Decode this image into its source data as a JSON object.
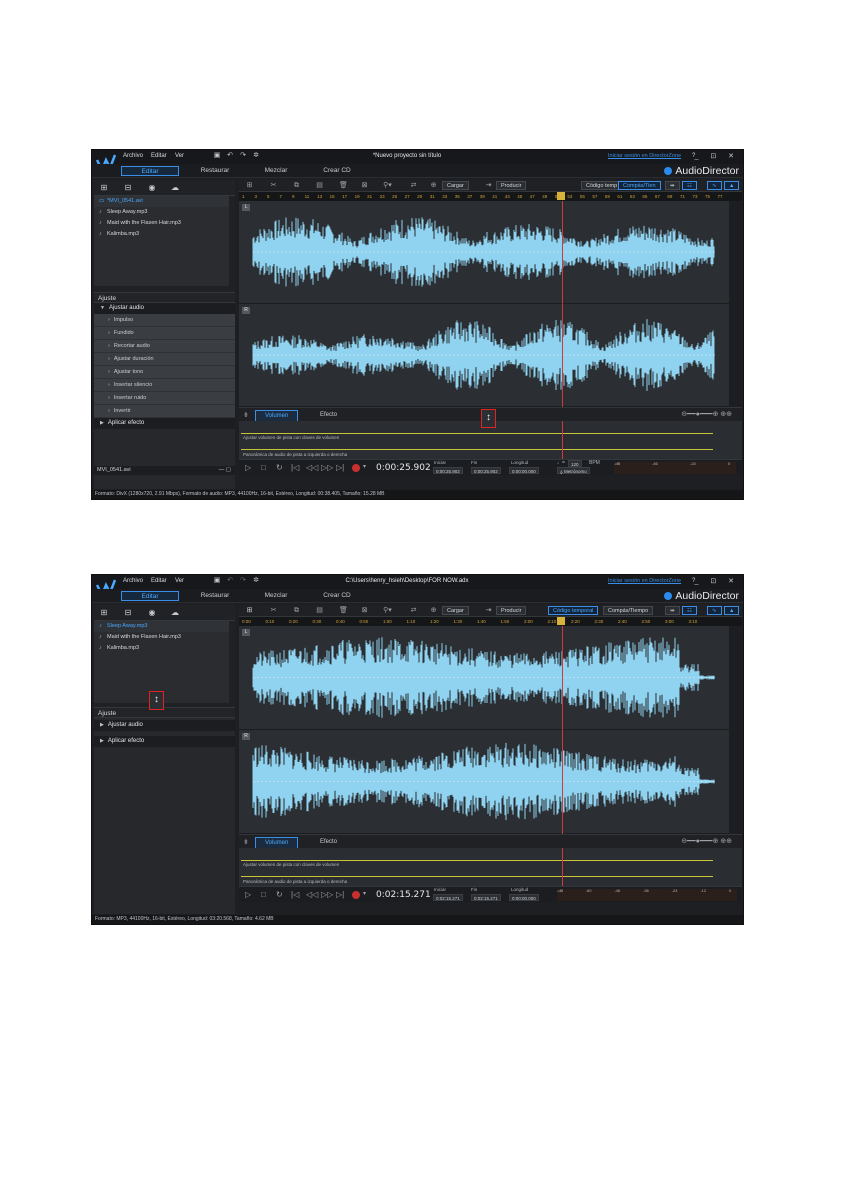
{
  "shot1": {
    "menu": [
      "Archivo",
      "Editar",
      "Ver"
    ],
    "title": "*Nuevo proyecto sin título",
    "signin": "Iniciar sesión en DirectorZone",
    "help": "?",
    "win_controls": "_ ⊡ ✕",
    "tabs": [
      "Editar",
      "Restaurar",
      "Mezclar",
      "Crear CD"
    ],
    "brand": "AudioDirector",
    "files": [
      "*MVI_0541.avi",
      "Sleep Away.mp3",
      "Maid with the Flaxen Hair.mp3",
      "Kalimba.mp3"
    ],
    "ajuste": "Ajuste",
    "ajustar_audio": "Ajustar audio",
    "sub_items": [
      "Impulso",
      "Fundido",
      "Recortar audio",
      "Ajustar duración",
      "Ajustar tono",
      "Insertar silencio",
      "Insertar ruido",
      "Invertir"
    ],
    "aplicar_efecto": "Aplicar efecto",
    "file_tab": "MVI_0541.avi",
    "cargar": "Cargar",
    "producir": "Producir",
    "codigo": "Código temp",
    "compas": "Compás/Tien",
    "ruler": [
      "1",
      "3",
      "5",
      "7",
      "9",
      "11",
      "13",
      "15",
      "17",
      "19",
      "21",
      "23",
      "25",
      "27",
      "29",
      "31",
      "33",
      "35",
      "37",
      "39",
      "41",
      "43",
      "45",
      "47",
      "49",
      "51",
      "53",
      "55",
      "57",
      "59",
      "61",
      "63",
      "65",
      "67",
      "69",
      "71",
      "73",
      "75",
      "77"
    ],
    "track_labels": [
      "L",
      "R"
    ],
    "volumen": "Volumen",
    "efecto": "Efecto",
    "env_vol": "Ajustar volumen de pista con claves de volumen",
    "env_pan": "Panorámica de audio de pista a izquierda o derecha",
    "timecode": "0:00:25.902",
    "iniciar": "Iniciar",
    "fin": "Fin",
    "longitud": "Longitud",
    "iniciar_val": "0:00:25.902",
    "fin_val": "0:00:25.902",
    "longitud_val": "0:00:00.000",
    "bpm_val": "120",
    "bpm": "BPM",
    "metronomo": "Metrónomo",
    "meter_scale": [
      "-dB",
      "-46",
      "-24",
      "0"
    ],
    "status": "Formato: DivX (1280x720, 2.91 Mbps), Formato de audio: MP3, 44100Hz, 16-bit, Estéreo, Longitud: 00:38.405, Tamaño: 15.28 MB"
  },
  "shot2": {
    "menu": [
      "Archivo",
      "Editar",
      "Ver"
    ],
    "title": "C:\\Users\\henry_hsieh\\Desktop\\FOR NOW.adx",
    "signin": "Iniciar sesión en DirectorZone",
    "help": "?",
    "win_controls": "_ ⊡ ✕",
    "tabs": [
      "Editar",
      "Restaurar",
      "Mezclar",
      "Crear CD"
    ],
    "brand": "AudioDirector",
    "files": [
      "Sleep Away.mp3",
      "Maid with the Flaxen Hair.mp3",
      "Kalimba.mp3"
    ],
    "ajuste": "Ajuste",
    "ajustar_audio": "Ajustar audio",
    "aplicar_efecto": "Aplicar efecto",
    "cargar": "Cargar",
    "producir": "Producir",
    "codigo": "Código temporal",
    "compas": "Compás/Tiempo",
    "ruler": [
      "0:00",
      "0:10",
      "0:20",
      "0:30",
      "0:40",
      "0:50",
      "1:00",
      "1:10",
      "1:20",
      "1:30",
      "1:40",
      "1:50",
      "2:00",
      "2:10",
      "2:20",
      "2:30",
      "2:40",
      "2:50",
      "3:00",
      "3:10"
    ],
    "track_labels": [
      "L",
      "R"
    ],
    "volumen": "Volumen",
    "efecto": "Efecto",
    "env_vol": "Ajustar volumen de pista con claves de volumen",
    "env_pan": "Panorámica de audio de pista a izquierda o derecha",
    "timecode": "0:02:15.271",
    "iniciar": "Iniciar",
    "fin": "Fin",
    "longitud": "Longitud",
    "iniciar_val": "0:02:15.271",
    "fin_val": "0:02:15.271",
    "longitud_val": "0:00:00.000",
    "meter_scale": [
      "-dB",
      "-60",
      "-46",
      "-36",
      "-24",
      "-12",
      "0"
    ],
    "status": "Formato: MP3, 44100Hz, 16-bit, Estéreo, Longitud: 03:20.568, Tamaño: 4.62 MB"
  },
  "colors": {
    "accent": "#3a8ee6",
    "waveform": "#8fd3f0",
    "playhead": "#d23a3a",
    "highlight_box": "#e02424",
    "envelope": "#c9c437"
  }
}
